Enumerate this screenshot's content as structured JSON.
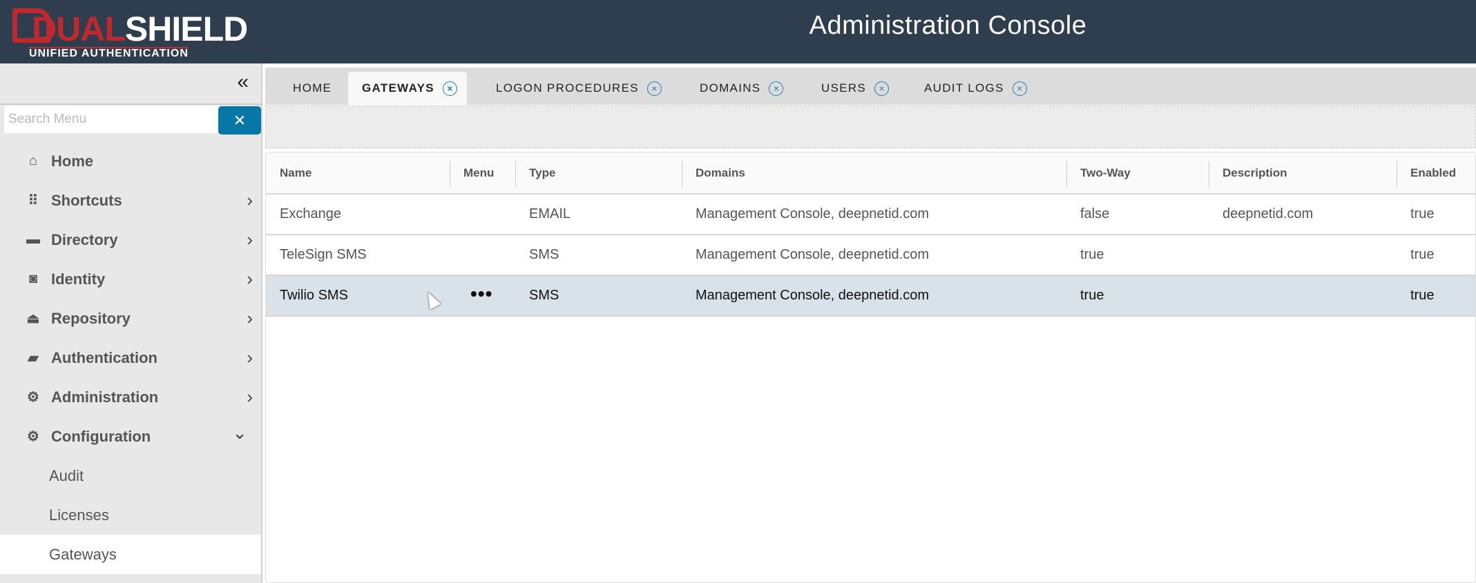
{
  "header": {
    "logo_text_red": "DUAL",
    "logo_text_white": "SHIELD",
    "logo_subtitle": "UNIFIED AUTHENTICATION",
    "title": "Administration Console"
  },
  "sidebar": {
    "collapse_icon": "«",
    "search_placeholder": "Search Menu",
    "search_clear": "✕",
    "items": [
      {
        "label": "Home",
        "icon": "home-icon",
        "glyph": "⌂"
      },
      {
        "label": "Shortcuts",
        "icon": "grid-icon",
        "glyph": "⠿",
        "chevron": "›"
      },
      {
        "label": "Directory",
        "icon": "folder-icon",
        "glyph": "▬",
        "chevron": "›"
      },
      {
        "label": "Identity",
        "icon": "id-badge-icon",
        "glyph": "◙",
        "chevron": "›"
      },
      {
        "label": "Repository",
        "icon": "bank-icon",
        "glyph": "⏏",
        "chevron": "›"
      },
      {
        "label": "Authentication",
        "icon": "wallet-icon",
        "glyph": "▰",
        "chevron": "›"
      },
      {
        "label": "Administration",
        "icon": "user-gear-icon",
        "glyph": "⚙",
        "chevron": "›"
      },
      {
        "label": "Configuration",
        "icon": "file-gear-icon",
        "glyph": "⚙",
        "chevron": "⌄"
      }
    ],
    "subitems": [
      {
        "label": "Audit"
      },
      {
        "label": "Licenses"
      },
      {
        "label": "Gateways"
      }
    ]
  },
  "tabs": [
    {
      "label": "HOME"
    },
    {
      "label": "GATEWAYS",
      "close": "×"
    },
    {
      "label": "LOGON PROCEDURES",
      "close": "×"
    },
    {
      "label": "DOMAINS",
      "close": "×"
    },
    {
      "label": "USERS",
      "close": "×"
    },
    {
      "label": "AUDIT LOGS",
      "close": "×"
    }
  ],
  "table": {
    "columns": [
      "Name",
      "Menu",
      "Type",
      "Domains",
      "Two-Way",
      "Description",
      "Enabled"
    ],
    "rows": [
      {
        "name": "Exchange",
        "menu": "",
        "type": "EMAIL",
        "domains": "Management Console, deepnetid.com",
        "two_way": "false",
        "description": "deepnetid.com",
        "enabled": "true"
      },
      {
        "name": "TeleSign SMS",
        "menu": "",
        "type": "SMS",
        "domains": "Management Console, deepnetid.com",
        "two_way": "true",
        "description": "",
        "enabled": "true"
      },
      {
        "name": "Twilio SMS",
        "menu": "•••",
        "type": "SMS",
        "domains": "Management Console, deepnetid.com",
        "two_way": "true",
        "description": "",
        "enabled": "true"
      }
    ]
  },
  "colors": {
    "header_bg": "#2f3e4e",
    "brand_red": "#c0282e",
    "accent": "#0877a8",
    "selected_row": "#d8e2e8"
  }
}
